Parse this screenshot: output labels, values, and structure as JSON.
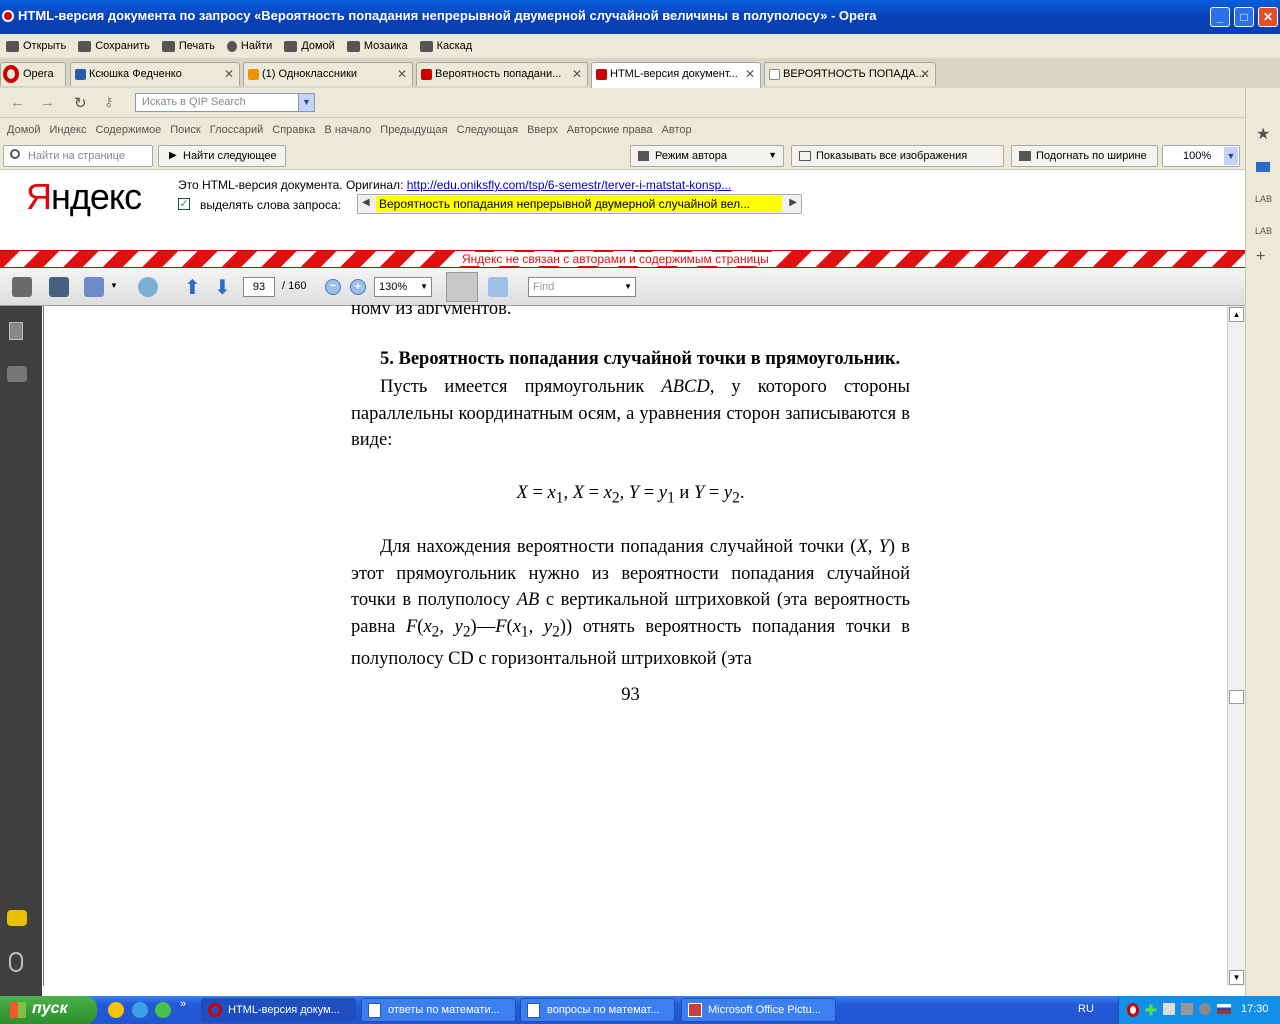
{
  "window": {
    "title": "HTML-версия документа по запросу «Вероятность попадания непрерывной двумерной случайной величины в полуполосу» - Opera"
  },
  "menu": [
    "Открыть",
    "Сохранить",
    "Печать",
    "Найти",
    "Домой",
    "Мозаика",
    "Каскад"
  ],
  "tabs": [
    {
      "label": "Opera"
    },
    {
      "label": "Ксюшка Федченко"
    },
    {
      "label": "(1) Одноклассники"
    },
    {
      "label": "Вероятность попадани..."
    },
    {
      "label": "HTML-версия документ..."
    },
    {
      "label": "ВЕРОЯТНОСТЬ ПОПАДА..."
    }
  ],
  "nav": {
    "search_placeholder": "Искать в QIP Search"
  },
  "links": [
    "Домой",
    "Индекс",
    "Содержимое",
    "Поиск",
    "Глоссарий",
    "Справка",
    "В начало",
    "Предыдущая",
    "Следующая",
    "Вверх",
    "Авторские права",
    "Автор"
  ],
  "findbar": {
    "find_placeholder": "Найти на странице",
    "find_next": "Найти следующее",
    "mode": "Режим автора",
    "show_images": "Показывать все изображения",
    "fit_width": "Подогнать по ширине",
    "zoom": "100%"
  },
  "yandex": {
    "logo_ya": "Я",
    "logo_rest": "ндекс",
    "original_label": "Это HTML-версия документа. Оригинал:",
    "original_url": "http://edu.oniksfly.com/tsp/6-semestr/terver-i-matstat-konsp...",
    "highlight_label": "выделять слова запроса:",
    "highlight_query": "Вероятность попадания непрерывной двумерной случайной вел...",
    "disclaimer": "Яндекс не связан с авторами и содержимым страницы"
  },
  "pdf": {
    "page": "93",
    "total": "/ 160",
    "zoom": "130%",
    "find_placeholder": "Find"
  },
  "doc": {
    "top_fragment": "ному из аргументов.",
    "heading": "5. Вероятность попадания случайной точки в прямоугольник.",
    "page_number": "93"
  },
  "taskbar": {
    "start": "пуск",
    "tasks": [
      "HTML-версия докум...",
      "ответы по математи...",
      "вопросы по математ...",
      "Microsoft Office Pictu..."
    ],
    "lang": "RU",
    "clock": "17:30"
  }
}
